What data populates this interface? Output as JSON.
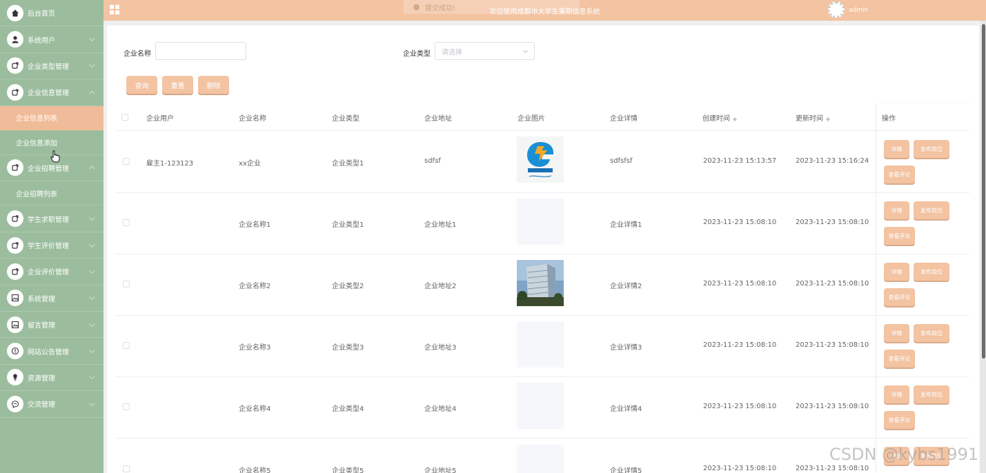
{
  "sidebar": {
    "items": [
      {
        "label": "后台首页",
        "icon": "home-icon"
      },
      {
        "label": "系统用户",
        "icon": "user-icon"
      },
      {
        "label": "企业类型管理",
        "icon": "tag-icon"
      },
      {
        "label": "企业信息管理",
        "icon": "tag-icon",
        "expanded": true
      },
      {
        "label": "企业信息列表",
        "sub": true,
        "active": true
      },
      {
        "label": "企业信息添加",
        "sub": true
      },
      {
        "label": "企业招聘管理",
        "icon": "tag-icon",
        "expanded": true
      },
      {
        "label": "企业招聘列表",
        "sub": true
      },
      {
        "label": "学生求职管理",
        "icon": "tag-icon"
      },
      {
        "label": "学生评价管理",
        "icon": "tag-icon"
      },
      {
        "label": "企业评价管理",
        "icon": "tag-icon"
      },
      {
        "label": "系统管理",
        "icon": "picture-icon"
      },
      {
        "label": "留言管理",
        "icon": "picture-icon"
      },
      {
        "label": "网站公告管理",
        "icon": "info-icon"
      },
      {
        "label": "资源管理",
        "icon": "bulb-icon"
      },
      {
        "label": "交流管理",
        "icon": "chat-icon"
      }
    ]
  },
  "header": {
    "title": "欢迎使用成都市大学生兼职信息系统",
    "toast": "提交成功!",
    "user": "admin"
  },
  "search": {
    "name_label": "企业名称",
    "type_label": "企业类型",
    "type_placeholder": "请选择",
    "query_btn": "查询",
    "reset_btn": "重置",
    "delete_btn": "删除"
  },
  "table": {
    "headers": [
      "企业用户",
      "企业名称",
      "企业类型",
      "企业地址",
      "企业图片",
      "企业详情",
      "创建时间",
      "更新时间",
      "操作"
    ],
    "rows": [
      {
        "user": "雇主1-123123",
        "name": "xx企业",
        "type": "企业类型1",
        "address": "sdfsf",
        "detail": "sdfsfsf",
        "created": "2023-11-23 15:13:57",
        "updated": "2023-11-23 15:16:24",
        "image": "tencent-games-logo"
      },
      {
        "user": "",
        "name": "企业名称1",
        "type": "企业类型1",
        "address": "企业地址1",
        "detail": "企业详情1",
        "created": "2023-11-23 15:08:10",
        "updated": "2023-11-23 15:08:10",
        "image": "empty"
      },
      {
        "user": "",
        "name": "企业名称2",
        "type": "企业类型2",
        "address": "企业地址2",
        "detail": "企业详情2",
        "created": "2023-11-23 15:08:10",
        "updated": "2023-11-23 15:08:10",
        "image": "building-photo"
      },
      {
        "user": "",
        "name": "企业名称3",
        "type": "企业类型3",
        "address": "企业地址3",
        "detail": "企业详情3",
        "created": "2023-11-23 15:08:10",
        "updated": "2023-11-23 15:08:10",
        "image": "empty"
      },
      {
        "user": "",
        "name": "企业名称4",
        "type": "企业类型4",
        "address": "企业地址4",
        "detail": "企业详情4",
        "created": "2023-11-23 15:08:10",
        "updated": "2023-11-23 15:08:10",
        "image": "empty"
      },
      {
        "user": "",
        "name": "企业名称5",
        "type": "企业类型5",
        "address": "企业地址5",
        "detail": "企业详情5",
        "created": "2023-11-23 15:08:10",
        "updated": "2023-11-23 15:08:10",
        "image": "empty"
      }
    ],
    "actions": {
      "detail": "详情",
      "publish": "发布岗位",
      "comments": "查看评论"
    }
  },
  "watermark": "CSDN @kybs1991",
  "colors": {
    "sidebar": "#9bbd9d",
    "accent": "#f3c3a2",
    "active": "#f0bb98"
  }
}
